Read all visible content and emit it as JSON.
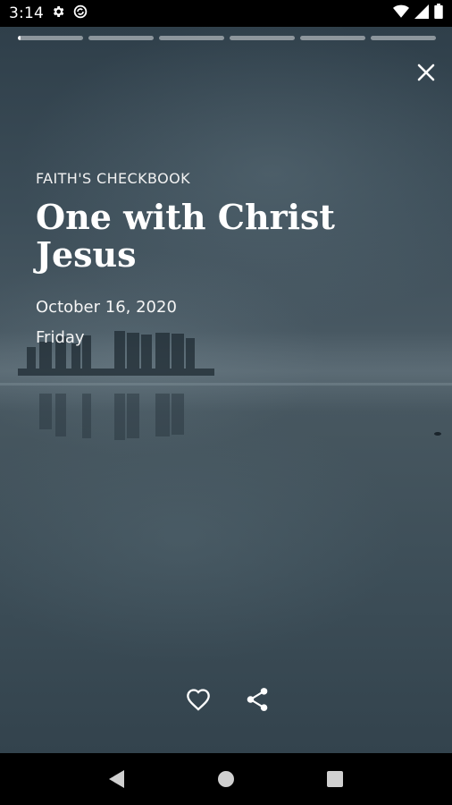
{
  "status_bar": {
    "time": "3:14",
    "icons": [
      "gear-icon",
      "data-saver-icon",
      "wifi-icon",
      "signal-icon",
      "battery-icon"
    ]
  },
  "story": {
    "progress": {
      "total_segments": 6,
      "current_index": 0,
      "current_fill": 0.04
    },
    "category": "FAITH'S CHECKBOOK",
    "title": "One with Christ Jesus",
    "date": "October 16, 2020",
    "weekday": "Friday"
  },
  "actions": {
    "icons": [
      "heart-outline-icon",
      "share-icon"
    ]
  },
  "navigation": {
    "icons": [
      "back-triangle-icon",
      "home-circle-icon",
      "recents-square-icon"
    ]
  },
  "colors": {
    "background_top": "#2f3f4a",
    "background_mid": "#4a5a64",
    "text": "#ffffff",
    "progress_track": "rgba(255,255,255,0.45)"
  }
}
